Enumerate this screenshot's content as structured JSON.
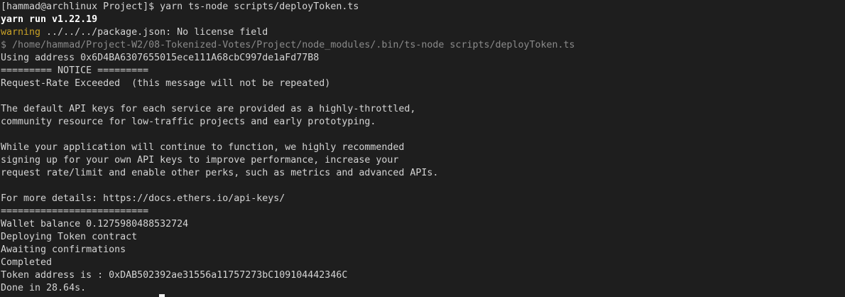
{
  "terminal": {
    "prompt": "[hammad@archlinux Project]$ ",
    "command": "yarn ts-node scripts/deployToken.ts",
    "yarn_version": "yarn run v1.22.19",
    "warning_label": "warning",
    "warning_text": " ../../../package.json: No license field",
    "exec_line": "$ /home/hammad/Project-W2/08-Tokenized-Votes/Project/node_modules/.bin/ts-node scripts/deployToken.ts",
    "output": [
      "Using address 0x6D4BA6307655015ece111A68cbC997de1aFd77B8",
      "========= NOTICE =========",
      "Request-Rate Exceeded  (this message will not be repeated)",
      "",
      "The default API keys for each service are provided as a highly-throttled,",
      "community resource for low-traffic projects and early prototyping.",
      "",
      "While your application will continue to function, we highly recommended",
      "signing up for your own API keys to improve performance, increase your",
      "request rate/limit and enable other perks, such as metrics and advanced APIs.",
      "",
      "For more details: https://docs.ethers.io/api-keys/",
      "==========================",
      "Wallet balance 0.1275980488532724",
      "Deploying Token contract",
      "Awaiting confirmations",
      "Completed",
      "Token address is : 0xDAB502392ae31556a11757273bC109104442346C",
      "Done in 28.64s."
    ]
  }
}
